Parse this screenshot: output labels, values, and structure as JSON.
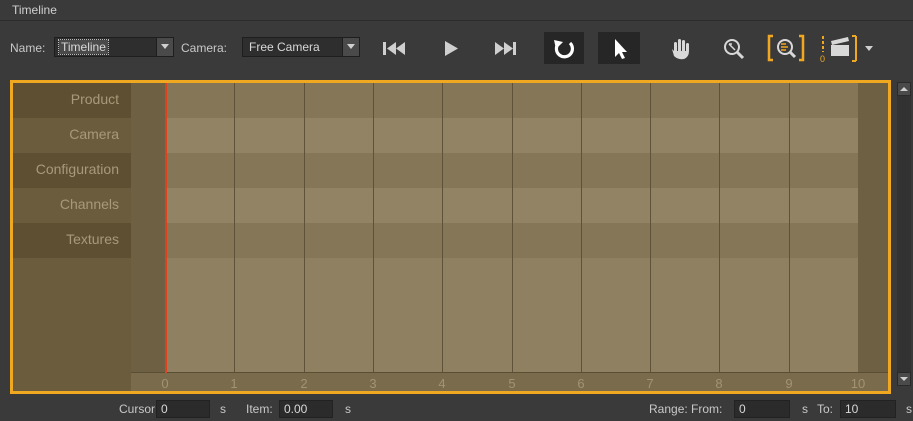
{
  "panel": {
    "title": "Timeline"
  },
  "toolbar": {
    "name_label": "Name:",
    "name_value": "Timeline",
    "camera_label": "Camera:",
    "camera_value": "Free Camera"
  },
  "tracks": {
    "rows": [
      "Product",
      "Camera",
      "Configuration",
      "Channels",
      "Textures"
    ]
  },
  "ruler": {
    "ticks": [
      "0",
      "1",
      "2",
      "3",
      "4",
      "5",
      "6",
      "7",
      "8",
      "9",
      "10"
    ]
  },
  "status": {
    "cursor_label": "Cursor:",
    "cursor_value": "0",
    "cursor_unit": "s",
    "item_label": "Item:",
    "item_value": "0.00",
    "item_unit": "s",
    "range_label": "Range: From:",
    "range_from_value": "0",
    "range_from_unit": "s",
    "range_to_label": "To:",
    "range_to_value": "10",
    "range_to_unit": "s"
  },
  "colors": {
    "accent": "#f0a820",
    "cursor": "#e04020",
    "track_bg": "#8a7c5e"
  },
  "icons": [
    "skip-start-icon",
    "play-icon",
    "skip-end-icon",
    "loop-icon",
    "pointer-icon",
    "hand-icon",
    "zoom-icon",
    "zoom-fit-icon",
    "clapper-icon",
    "dropdown-icon"
  ]
}
